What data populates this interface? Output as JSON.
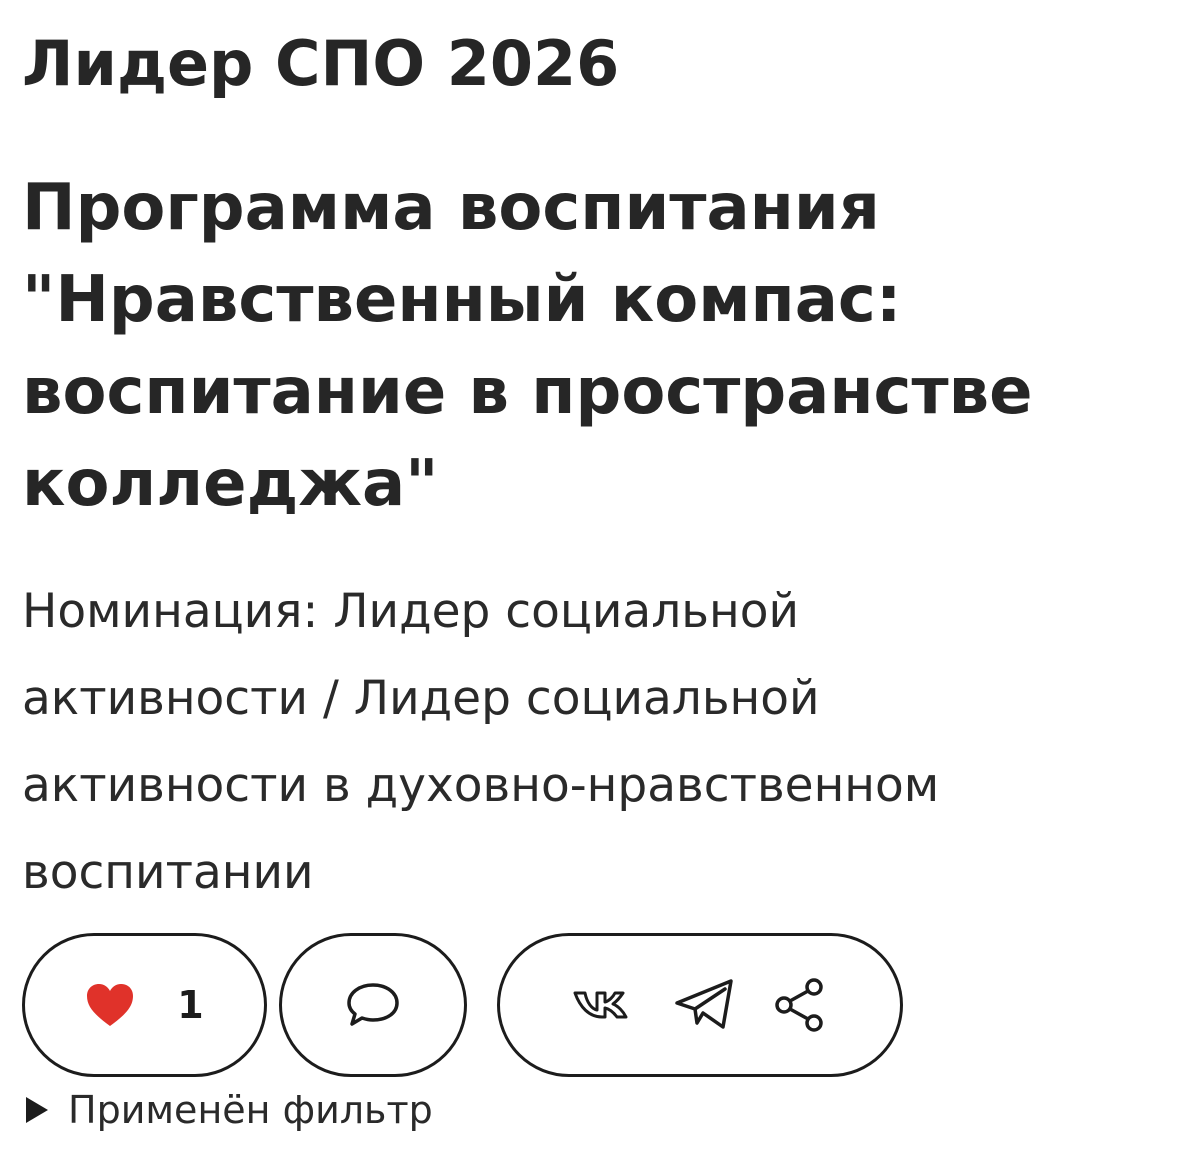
{
  "page": {
    "title": "Лидер СПО 2026"
  },
  "project": {
    "title_lines": [
      "Программа воспитания",
      "\"Нравственный компас:",
      "воспитание в пространстве",
      "колледжа\""
    ],
    "nomination_lines": [
      "Номинация: Лидер социальной",
      "активности / Лидер социальной",
      "активности в духовно-нравственном",
      "воспитании"
    ]
  },
  "actions": {
    "like_count": "1",
    "like_icon": "heart-icon",
    "comment_icon": "speech-bubble-icon",
    "share_icons": [
      "vk-icon",
      "telegram-icon",
      "share-icon"
    ],
    "heart_color": "#e0322a"
  },
  "filter": {
    "label": "Применён фильтр"
  }
}
